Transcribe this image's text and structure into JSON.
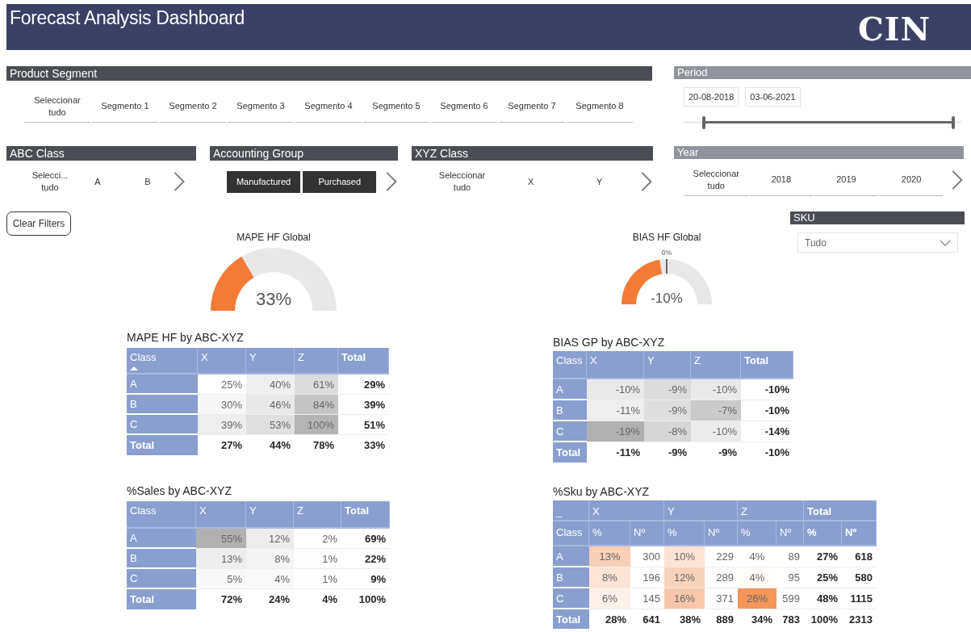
{
  "header": {
    "title": "Forecast Analysis Dashboard",
    "logo": "CIN"
  },
  "product_segment": {
    "title": "Product Segment",
    "items": [
      {
        "label": "Seleccionar tudo",
        "selected": false
      },
      {
        "label": "Segmento 1",
        "selected": false
      },
      {
        "label": "Segmento 2",
        "selected": false
      },
      {
        "label": "Segmento 3",
        "selected": false
      },
      {
        "label": "Segmento 4",
        "selected": false
      },
      {
        "label": "Segmento 5",
        "selected": false
      },
      {
        "label": "Segmento 6",
        "selected": false
      },
      {
        "label": "Segmento 7",
        "selected": false
      },
      {
        "label": "Segmento 8",
        "selected": false
      }
    ]
  },
  "period": {
    "title": "Period",
    "start": "20-08-2018",
    "end": "03-06-2021",
    "level": 0.97
  },
  "abc_class": {
    "title": "ABC Class",
    "items": [
      {
        "label": "Selecci... tudo",
        "selected": false
      },
      {
        "label": "A",
        "selected": false
      },
      {
        "label": "B",
        "selected": false
      }
    ]
  },
  "accounting_group": {
    "title": "Accounting Group",
    "items": [
      {
        "label": "Manufactured",
        "selected": true
      },
      {
        "label": "Purchased",
        "selected": true
      }
    ]
  },
  "xyz_class": {
    "title": "XYZ Class",
    "items": [
      {
        "label": "Seleccionar tudo",
        "selected": false
      },
      {
        "label": "X",
        "selected": false
      },
      {
        "label": "Y",
        "selected": false
      }
    ]
  },
  "year": {
    "title": "Year",
    "items": [
      {
        "label": "Seleccionar tudo",
        "selected": false
      },
      {
        "label": "2018",
        "selected": false
      },
      {
        "label": "2019",
        "selected": false
      },
      {
        "label": "2020",
        "selected": false
      }
    ]
  },
  "clear_filters": "Clear Filters",
  "sku_filter": {
    "title": "SKU",
    "value": "Tudo"
  },
  "mape_gauge": {
    "title": "MAPE HF Global",
    "value": "33%"
  },
  "bias_gauge": {
    "title": "BIAS HF Global",
    "value": "-10%",
    "target_label": "0%"
  },
  "mape_table": {
    "title": "MAPE HF by ABC-XYZ",
    "columns": [
      {
        "label": "Class",
        "sorted": true
      },
      {
        "label": "X",
        "sorted": false
      },
      {
        "label": "Y",
        "sorted": false
      },
      {
        "label": "Z",
        "sorted": false
      },
      {
        "label": "Total",
        "sorted": false
      }
    ],
    "rows": [
      {
        "label": "A",
        "cells": [
          {
            "text": "25%",
            "color": "#ffffff"
          },
          {
            "text": "40%",
            "color": "#efefef"
          },
          {
            "text": "61%",
            "color": "#dcdcdc"
          }
        ],
        "totals": [
          "29%"
        ]
      },
      {
        "label": "B",
        "cells": [
          {
            "text": "30%",
            "color": "#f7f7f7"
          },
          {
            "text": "46%",
            "color": "#e8e8e8"
          },
          {
            "text": "84%",
            "color": "#c4c4c4"
          }
        ],
        "totals": [
          "39%"
        ]
      },
      {
        "label": "C",
        "cells": [
          {
            "text": "39%",
            "color": "#eeeeee"
          },
          {
            "text": "53%",
            "color": "#e0e0e0"
          },
          {
            "text": "100%",
            "color": "#b4b4b4"
          }
        ],
        "totals": [
          "51%"
        ]
      }
    ],
    "total_row": {
      "label": "Total",
      "values": [
        "27%",
        "44%",
        "78%",
        "33%"
      ]
    }
  },
  "bias_table": {
    "title": "BIAS GP by ABC-XYZ",
    "columns": [
      {
        "label": "Class",
        "sorted": false
      },
      {
        "label": "X",
        "sorted": false
      },
      {
        "label": "Y",
        "sorted": false
      },
      {
        "label": "Z",
        "sorted": false
      },
      {
        "label": "Total",
        "sorted": false
      }
    ],
    "rows": [
      {
        "label": "A",
        "cells": [
          {
            "text": "-10%",
            "color": "#e9e9e9"
          },
          {
            "text": "-9%",
            "color": "#dcdcdc"
          },
          {
            "text": "-10%",
            "color": "#e9e9e9"
          }
        ],
        "totals": [
          "-10%"
        ]
      },
      {
        "label": "B",
        "cells": [
          {
            "text": "-11%",
            "color": "#eeeeee"
          },
          {
            "text": "-9%",
            "color": "#dedede"
          },
          {
            "text": "-7%",
            "color": "#cacaca"
          }
        ],
        "totals": [
          "-10%"
        ]
      },
      {
        "label": "C",
        "cells": [
          {
            "text": "-19%",
            "color": "#b0b0b0"
          },
          {
            "text": "-8%",
            "color": "#d6d6d6"
          },
          {
            "text": "-10%",
            "color": "#ebebeb"
          }
        ],
        "totals": [
          "-14%"
        ]
      }
    ],
    "total_row": {
      "label": "Total",
      "values": [
        "-11%",
        "-9%",
        "-9%",
        "-10%"
      ]
    }
  },
  "sales_table": {
    "title": "%Sales by ABC-XYZ",
    "columns": [
      {
        "label": "Class",
        "sorted": false
      },
      {
        "label": "X",
        "sorted": false
      },
      {
        "label": "Y",
        "sorted": false
      },
      {
        "label": "Z",
        "sorted": false
      },
      {
        "label": "Total",
        "sorted": false
      }
    ],
    "rows": [
      {
        "label": "A",
        "cells": [
          {
            "text": "55%",
            "color": "#b1b1b1"
          },
          {
            "text": "12%",
            "color": "#ececec"
          },
          {
            "text": "2%",
            "color": "#ffffff"
          }
        ],
        "totals": [
          "69%"
        ]
      },
      {
        "label": "B",
        "cells": [
          {
            "text": "13%",
            "color": "#ededed"
          },
          {
            "text": "8%",
            "color": "#f5f5f5"
          },
          {
            "text": "1%",
            "color": "#fefefe"
          }
        ],
        "totals": [
          "22%"
        ]
      },
      {
        "label": "C",
        "cells": [
          {
            "text": "5%",
            "color": "#f8f8f8"
          },
          {
            "text": "4%",
            "color": "#f9f9f9"
          },
          {
            "text": "1%",
            "color": "#fefefe"
          }
        ],
        "totals": [
          "9%"
        ]
      }
    ],
    "total_row": {
      "label": "Total",
      "values": [
        "72%",
        "24%",
        "4%",
        "100%"
      ]
    }
  },
  "sku_table": {
    "title": "%Sku by ABC-XYZ",
    "corner": "_",
    "class_label": "Class",
    "groups": [
      {
        "label": "X",
        "columns": [
          "%",
          "Nº"
        ]
      },
      {
        "label": "Y",
        "columns": [
          "%",
          "Nº"
        ]
      },
      {
        "label": "Z",
        "columns": [
          "%",
          "Nº"
        ]
      },
      {
        "label": "Total",
        "columns": [
          "%",
          "Nº"
        ]
      }
    ],
    "rows": [
      {
        "label": "A",
        "cells": [
          {
            "text": "13%",
            "color": "#f9cfb5"
          },
          {
            "text": "300",
            "color": "#ffffff"
          },
          {
            "text": "10%",
            "color": "#fbe3d6"
          },
          {
            "text": "229",
            "color": "#ffffff"
          },
          {
            "text": "4%",
            "color": "#ffffff"
          },
          {
            "text": "89",
            "color": "#ffffff"
          }
        ],
        "totals": [
          "27%",
          "618"
        ]
      },
      {
        "label": "B",
        "cells": [
          {
            "text": "8%",
            "color": "#fce4d6"
          },
          {
            "text": "196",
            "color": "#ffffff"
          },
          {
            "text": "12%",
            "color": "#f9d2ba"
          },
          {
            "text": "289",
            "color": "#ffffff"
          },
          {
            "text": "4%",
            "color": "#fffcfa"
          },
          {
            "text": "95",
            "color": "#ffffff"
          }
        ],
        "totals": [
          "25%",
          "580"
        ]
      },
      {
        "label": "C",
        "cells": [
          {
            "text": "6%",
            "color": "#fdf1ea"
          },
          {
            "text": "145",
            "color": "#ffffff"
          },
          {
            "text": "16%",
            "color": "#f8c7a9"
          },
          {
            "text": "371",
            "color": "#ffffff"
          },
          {
            "text": "26%",
            "color": "#f4955a"
          },
          {
            "text": "599",
            "color": "#ffffff"
          }
        ],
        "totals": [
          "48%",
          "1115"
        ]
      }
    ],
    "total_row": {
      "label": "Total",
      "values": [
        "28%",
        "641",
        "38%",
        "889",
        "34%",
        "783",
        "100%",
        "2313"
      ]
    }
  }
}
